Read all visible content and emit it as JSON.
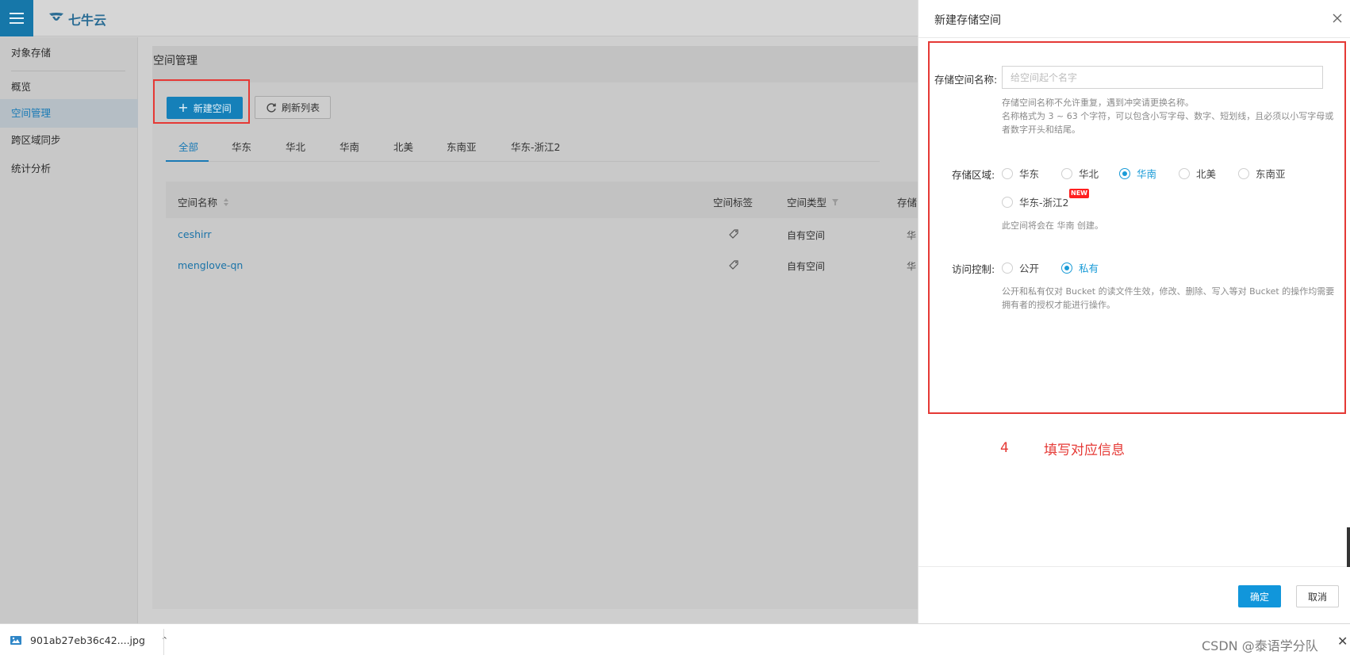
{
  "app": {
    "logo_text": "七牛云"
  },
  "sidebar": {
    "items": [
      {
        "label": "对象存储"
      },
      {
        "label": "概览"
      },
      {
        "label": "空间管理"
      },
      {
        "label": "跨区域同步"
      },
      {
        "label": "统计分析"
      }
    ]
  },
  "main": {
    "title": "空间管理",
    "new_button": "新建空间",
    "refresh_button": "刷新列表",
    "tabs": [
      "全部",
      "华东",
      "华北",
      "华南",
      "北美",
      "东南亚",
      "华东-浙江2"
    ],
    "table": {
      "headers": [
        "空间名称",
        "空间标签",
        "空间类型",
        "存储"
      ],
      "rows": [
        {
          "name": "ceshirr",
          "type": "自有空间",
          "more": "华"
        },
        {
          "name": "menglove-qn",
          "type": "自有空间",
          "more": "华"
        }
      ]
    }
  },
  "drawer": {
    "title": "新建存储空间",
    "name_label": "存储空间名称:",
    "name_placeholder": "给空间起个名字",
    "name_hint_1": "存储空间名称不允许重复，遇到冲突请更换名称。",
    "name_hint_2": "名称格式为 3 ~ 63 个字符，可以包含小写字母、数字、短划线，且必须以小写字母或者数字开头和结尾。",
    "region_label": "存储区域:",
    "regions": [
      "华东",
      "华北",
      "华南",
      "北美",
      "东南亚",
      "华东-浙江2"
    ],
    "region_selected": "华南",
    "new_badge": "NEW",
    "region_hint": "此空间将会在 华南 创建。",
    "access_label": "访问控制:",
    "access_options": [
      "公开",
      "私有"
    ],
    "access_selected": "私有",
    "access_hint": "公开和私有仅对 Bucket 的读文件生效，修改、删除、写入等对 Bucket 的操作均需要拥有者的授权才能进行操作。",
    "annotation_number": "4",
    "annotation_text": "填写对应信息",
    "ok_button": "确定",
    "cancel_button": "取消"
  },
  "download_bar": {
    "file_name": "901ab27eb36c42....jpg",
    "watermark": "CSDN @泰语学分队"
  },
  "colors": {
    "primary": "#1196db",
    "highlight_red": "#e53935",
    "link": "#1a73a8"
  }
}
